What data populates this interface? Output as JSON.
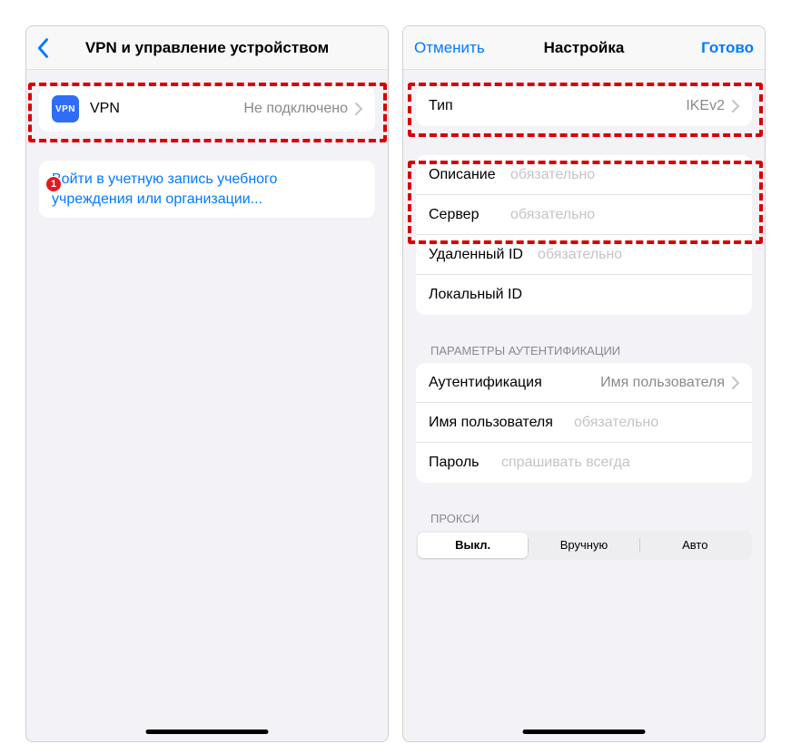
{
  "left": {
    "title": "VPN и управление устройством",
    "vpn": {
      "badge": "VPN",
      "label": "VPN",
      "status": "Не подключено"
    },
    "signinLink": "Войти в учетную запись учебного учреждения или организации..."
  },
  "right": {
    "cancel": "Отменить",
    "title": "Настройка",
    "done": "Готово",
    "type": {
      "label": "Тип",
      "value": "IKEv2"
    },
    "description": {
      "label": "Описание",
      "placeholder": "обязательно"
    },
    "server": {
      "label": "Сервер",
      "placeholder": "обязательно"
    },
    "remoteId": {
      "label": "Удаленный ID",
      "placeholder": "обязательно"
    },
    "localId": {
      "label": "Локальный ID"
    },
    "authHeader": "ПАРАМЕТРЫ АУТЕНТИФИКАЦИИ",
    "auth": {
      "label": "Аутентификация",
      "value": "Имя пользователя"
    },
    "username": {
      "label": "Имя пользователя",
      "placeholder": "обязательно"
    },
    "password": {
      "label": "Пароль",
      "placeholder": "спрашивать всегда"
    },
    "proxyHeader": "ПРОКСИ",
    "proxy": {
      "off": "Выкл.",
      "manual": "Вручную",
      "auto": "Авто"
    }
  },
  "annotations": {
    "step1": "1"
  }
}
